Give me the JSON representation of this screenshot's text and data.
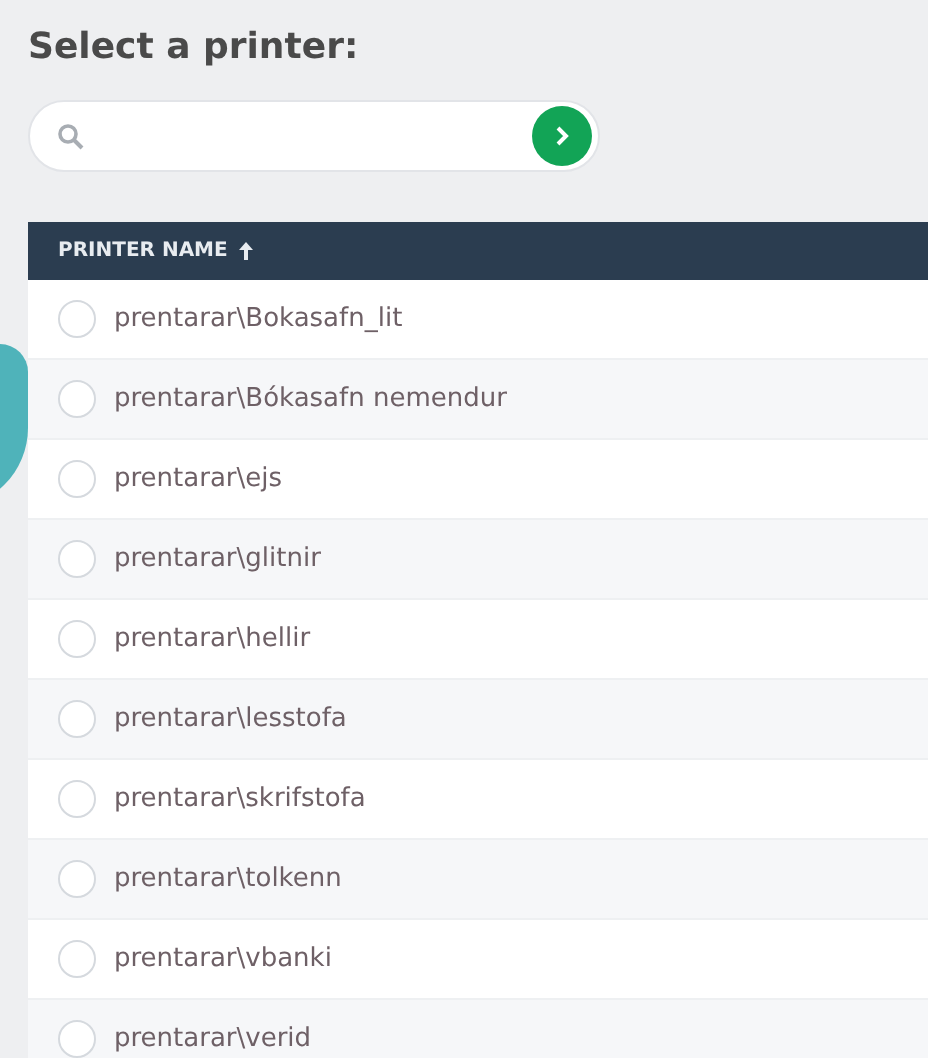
{
  "title": "Select a printer:",
  "table": {
    "columns": [
      {
        "label": "PRINTER NAME",
        "sorted": true
      }
    ],
    "rows": [
      {
        "name": "prentarar\\Bokasafn_lit",
        "selected": false
      },
      {
        "name": "prentarar\\Bókasafn nemendur",
        "selected": false
      },
      {
        "name": "prentarar\\ejs",
        "selected": false
      },
      {
        "name": "prentarar\\glitnir",
        "selected": false
      },
      {
        "name": "prentarar\\hellir",
        "selected": false
      },
      {
        "name": "prentarar\\lesstofa",
        "selected": false
      },
      {
        "name": "prentarar\\skrifstofa",
        "selected": false
      },
      {
        "name": "prentarar\\tolkenn",
        "selected": false
      },
      {
        "name": "prentarar\\vbanki",
        "selected": false
      },
      {
        "name": "prentarar\\verid",
        "selected": false
      }
    ]
  }
}
